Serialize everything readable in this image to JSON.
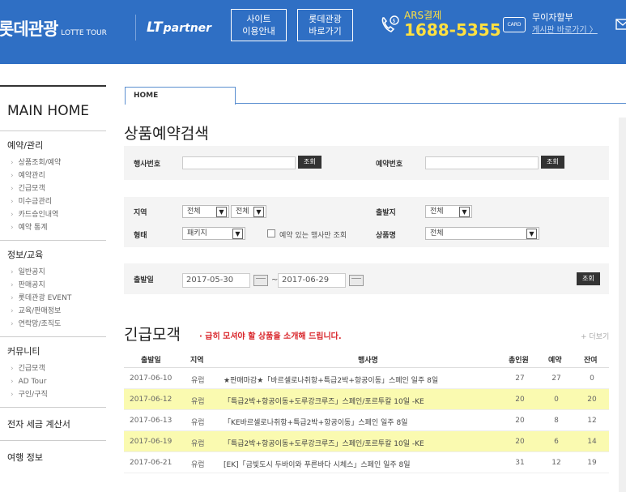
{
  "header": {
    "logo": "롯데관광",
    "logo_sub": "LOTTE TOUR",
    "partner": "partner",
    "partner_mark": "LT",
    "site_guide_line1": "사이트",
    "site_guide_line2": "이용안내",
    "lotte_shortcut_line1": "롯데관광",
    "lotte_shortcut_line2": "바로가기",
    "ars_label": "ARS결제",
    "ars_number": "1688-5355",
    "card_icon_text": "CARD",
    "installment_title": "무이자할부",
    "installment_link": "게시판 바로가기 〉"
  },
  "sidebar": {
    "main_home": "MAIN HOME",
    "sections": [
      {
        "title": "예약/관리",
        "items": [
          "상품조회/예약",
          "예약관리",
          "긴급모객",
          "미수금관리",
          "카드승인내역",
          "예약 통계"
        ]
      },
      {
        "title": "정보/교육",
        "items": [
          "일반공지",
          "판매공지",
          "롯데관광 EVENT",
          "교육/판매정보",
          "연락망/조직도"
        ]
      },
      {
        "title": "커뮤니티",
        "items": [
          "긴급모객",
          "AD Tour",
          "구인/구직"
        ]
      },
      {
        "title": "전자 세금 계산서",
        "items": []
      },
      {
        "title": "여행 정보",
        "items": []
      }
    ]
  },
  "tab": {
    "home": "HOME"
  },
  "search": {
    "title": "상품예약검색",
    "event_no_label": "행사번호",
    "reservation_no_label": "예약번호",
    "query_button": "조회",
    "region_label": "지역",
    "region_value1": "전체",
    "region_value2": "전체",
    "departure_label": "출발지",
    "departure_value": "전체",
    "type_label": "형태",
    "type_value": "패키지",
    "only_reserved_label": "예약 있는 행사만 조회",
    "product_name_label": "상품명",
    "product_name_value": "전체",
    "departure_date_label": "출발일",
    "date_from": "2017-05-30",
    "date_to": "2017-06-29",
    "tilde": "~"
  },
  "urgent": {
    "title": "긴급모객",
    "subtitle": "· 급히 모셔야 할 상품을 소개해 드립니다.",
    "more": "+ 더보기",
    "columns": [
      "출발일",
      "지역",
      "행사명",
      "총인원",
      "예약",
      "잔여"
    ],
    "rows": [
      {
        "date": "2017-06-10",
        "region": "유럽",
        "name": "★판매마감★「바르셀로나취항+특급2박+항공이동」스페인 일주 8일",
        "total": "27",
        "reserved": "27",
        "remaining": "0",
        "highlight": false
      },
      {
        "date": "2017-06-12",
        "region": "유럽",
        "name": "「특급2박+항공이동+도루강크루즈」스페인/포르투칼 10일 -KE",
        "total": "20",
        "reserved": "0",
        "remaining": "20",
        "highlight": true
      },
      {
        "date": "2017-06-13",
        "region": "유럽",
        "name": "「KE바르셀로나취항+특급2박+항공이동」스페인 일주 8일",
        "total": "20",
        "reserved": "8",
        "remaining": "12",
        "highlight": false
      },
      {
        "date": "2017-06-19",
        "region": "유럽",
        "name": "「특급2박+항공이동+도루강크루즈」스페인/포르투칼 10일 -KE",
        "total": "20",
        "reserved": "6",
        "remaining": "14",
        "highlight": true
      },
      {
        "date": "2017-06-21",
        "region": "유럽",
        "name": "[EK]「금빛도시 두바이와 푸른바다 시체스」스페인 일주 8일",
        "total": "31",
        "reserved": "12",
        "remaining": "19",
        "highlight": false
      }
    ]
  }
}
